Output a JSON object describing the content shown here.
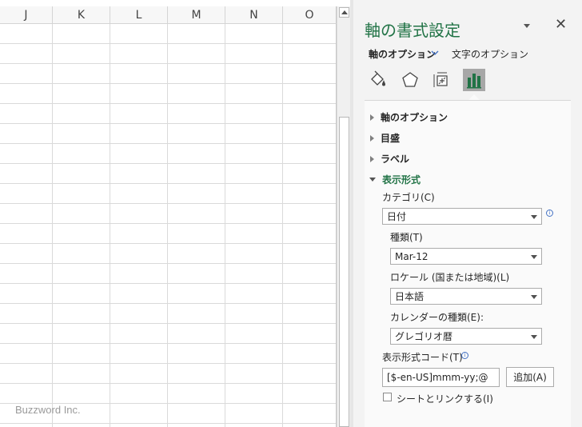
{
  "sheet": {
    "columns": [
      "J",
      "K",
      "L",
      "M",
      "N",
      "O"
    ],
    "watermark": "Buzzword Inc."
  },
  "pane": {
    "title": "軸の書式設定",
    "tabs": {
      "axis_options": "軸のオプション",
      "text_options": "文字のオプション"
    },
    "icons": [
      "fill-line-icon",
      "effects-icon",
      "size-properties-icon",
      "axis-options-icon"
    ],
    "sections": {
      "axis_options": "軸のオプション",
      "tick_marks": "目盛",
      "labels": "ラベル",
      "number": "表示形式"
    },
    "number": {
      "category_label": "カテゴリ(C)",
      "category_value": "日付",
      "type_label": "種類(T)",
      "type_value": "Mar-12",
      "locale_label": "ロケール (国または地域)(L)",
      "locale_value": "日本語",
      "calendar_label": "カレンダーの種類(E):",
      "calendar_value": "グレゴリオ暦",
      "format_code_label": "表示形式コード(T)",
      "format_code_value": "[$-en-US]mmm-yy;@",
      "add_button": "追加(A)",
      "link_label": "シートとリンクする(I)",
      "info_glyph": "i"
    },
    "colors": {
      "accent": "#217346",
      "selected_icon_bg": "#a7a7a7"
    }
  }
}
